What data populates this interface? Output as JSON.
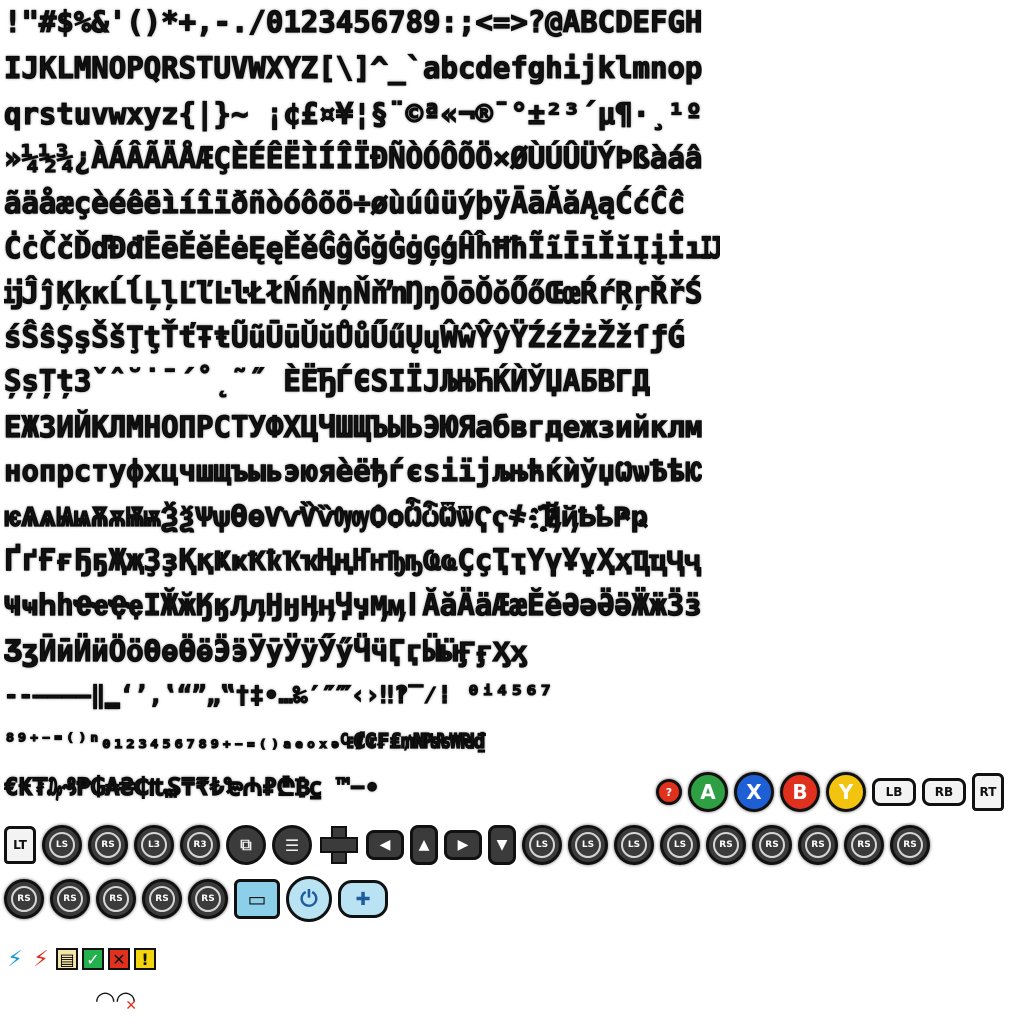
{
  "rows": [
    "!\"#$%&'()*+,-./0123456789:;<=>?@ABCDEFGH",
    "IJKLMNOPQRSTUVWXYZ[\\]^_`abcdefghijklmnop",
    "qrstuvwxyz{|}~ ¡¢£¤¥¦§¨©ª«¬®¯°±²³´µ¶·¸¹º",
    "»¼½¾¿ÀÁÂÃÄÅÆÇÈÉÊËÌÍÎÏÐÑÒÓÔÕÖ×ØÙÚÛÜÝÞßàáâ",
    "ãäåæçèéêëìíîïðñòóôõö÷øùúûüýþÿĀāĂăĄąĆćĈĉ",
    "ĊċČčĎďĐđĒēĔĕĖėĘęĚěĜĝĞğĠġĢģĤĥĦħĨĩĪīĬĭĮįİıĲ",
    "ĳĴĵĶķĸĹĺĻļĽľĿŀŁłŃńŅņŇňŉŊŋŌōŎŏŐőŒœŔŕŖŗŘřŚ",
    "śŜŝŞşŠšŢţŤťŦŧŨũŪūŬŭŮůŰűŲųŴŵŶŷŸŹźŻżŽžſƒǴ",
    "ȘșȚțЗˇˆ˘˙ˉ´˚˛˜˝ ЀЁЂЃЄЅІЇЈЉЊЋЌЍЎЏАБВГД",
    "ЕЖЗИЙКЛМНОПРСТУФХЦЧШЩЪЫЬЭЮЯабвгдежзийклм",
    "нопрстуфхцчшщъыьэюяѐёђѓєѕіїјљњћќѝўџѠѡѢѣѤ",
    "ѥѦѧѨѩѪѫѬѭѮѯѰѱѲѳѴѵѶѷѸѹѺѻѼѽѾѿҀҁ҂ ҃҄҈҉ҊҋҌҍҎҏ",
    "ҐґҒғҔҕҖҗҘҙҚқҜҝҞҟҠҡҢңҤҥҦҧҨҩҪҫҬҭҮүҰұҲҳҴҵҶҷ",
    "ҸҹҺһҼҽҾҿӀӁӂӃӄӅӆӇӈӉӊӋӌӍӎӏӐӑӒӓӔӕӖӗӘәӚӛӜӝӞӟ",
    "ӠӡӢӣӤӥӦӧӨөӪӫӬӭӮӯӰӱӲӳӴӵӶӷӸӹӺӻӼӽ",
    " ‐‑‒–—―‖‗‘’‚‛“”„‟†‡•…‰′″‴‹›‼‽‾⁄⁞ ⁰ⁱ⁴⁵⁶⁷",
    "⁸⁹⁺⁻⁼⁽⁾ⁿ₀₁₂₃₄₅₆₇₈₉₊₋₌₍₎ₐₑₒₓₔ₠₡₢₣₤₥₦₧₨₩₪₫",
    "€₭₮₯₰₱₲₳₴₵₶₷₸₹₺₻₼₽₾₿⃀ ™−∙"
  ],
  "icons_row_1": {
    "face_a": "A",
    "face_x": "X",
    "face_b": "B",
    "face_y": "Y",
    "lb": "LB",
    "rb": "RB",
    "rt": "RT"
  },
  "icons_row_2": {
    "lt": "LT",
    "ls": "LS",
    "rs": "RS",
    "l3": "L3",
    "r3": "R3"
  },
  "icons_row_3": {
    "rs": "RS"
  },
  "colors": {
    "xbox_a": "#2ea043",
    "xbox_x": "#1f5fd6",
    "xbox_b": "#e0301e",
    "xbox_y": "#f2c40f",
    "ps_blue": "#b9e3f3",
    "lightning_blue": "#1a9ad6",
    "lightning_red": "#e0301e",
    "check_green": "#22b14c",
    "cross_red": "#e0301e",
    "warn_yellow": "#f2d40f"
  },
  "status_icons": [
    "lightning-blue-icon",
    "lightning-red-icon",
    "battery-icon",
    "check-icon",
    "cross-icon",
    "warning-icon"
  ],
  "wifi_icons": [
    "wifi-icon",
    "wifi-off-icon"
  ]
}
